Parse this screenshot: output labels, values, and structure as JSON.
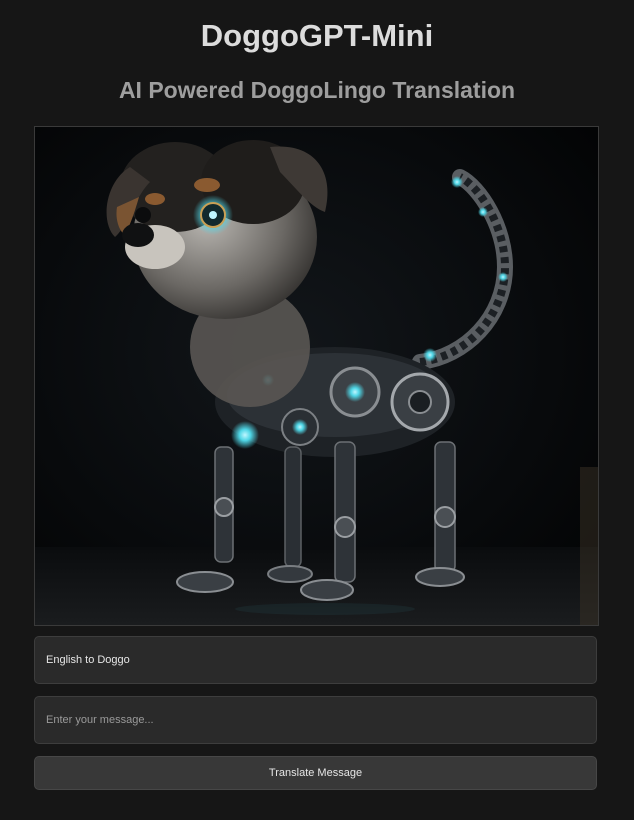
{
  "app": {
    "title": "DoggoGPT-Mini",
    "subtitle": "AI Powered DoggoLingo Translation"
  },
  "hero_image": {
    "subject": "robotic-puppy-illustration"
  },
  "translator": {
    "direction_selected": "English to Doggo",
    "message_placeholder": "Enter your message...",
    "message_value": "",
    "submit_label": "Translate Message"
  },
  "colors": {
    "background": "#161616",
    "title": "#dcdcdc",
    "subtitle": "#9e9e9e",
    "field": "#2a2a2a",
    "button": "#383838",
    "accent_glow": "#4fd6e6"
  }
}
